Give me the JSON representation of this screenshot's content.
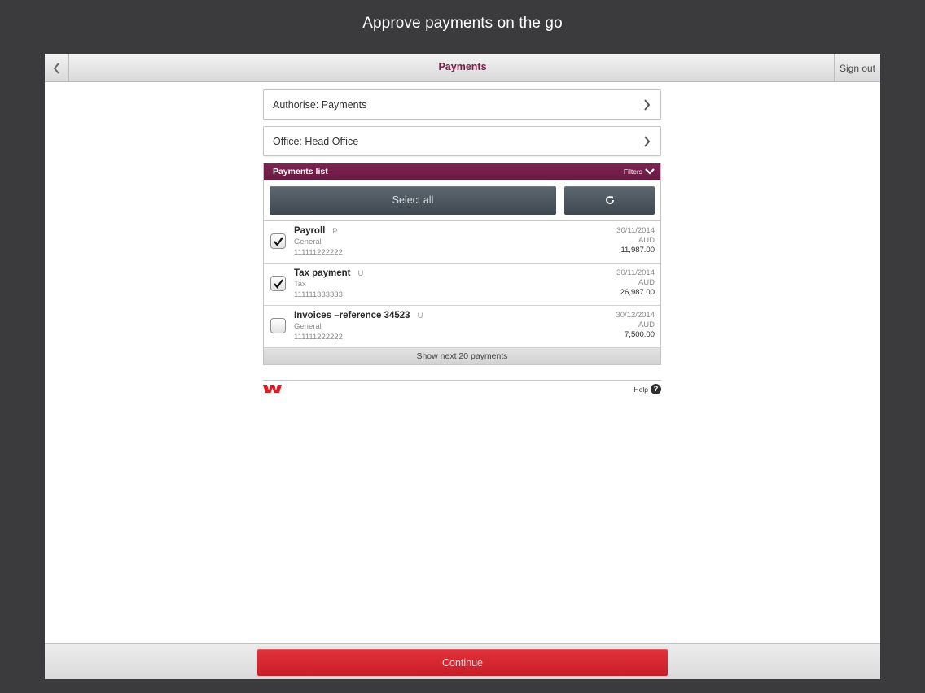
{
  "caption": "Approve payments on the go",
  "navbar": {
    "title": "Payments",
    "sign_out": "Sign out",
    "back_icon": "chevron-left-icon"
  },
  "selectors": [
    {
      "label": "Authorise: Payments"
    },
    {
      "label": "Office: Head Office"
    }
  ],
  "payments_panel": {
    "title": "Payments list",
    "filters_label": "Filters",
    "select_all_label": "Select all",
    "refresh_icon": "refresh-icon",
    "rows": [
      {
        "name": "Payroll",
        "code": "P",
        "type": "General",
        "account": "111111222222",
        "date": "30/11/2014",
        "currency": "AUD",
        "amount": "11,987.00",
        "checked": true
      },
      {
        "name": "Tax payment",
        "code": "U",
        "type": "Tax",
        "account": "111111333333",
        "date": "30/11/2014",
        "currency": "AUD",
        "amount": "26,987.00",
        "checked": true
      },
      {
        "name": "Invoices –reference 34523",
        "code": "U",
        "type": "General",
        "account": "111111222222",
        "date": "30/12/2014",
        "currency": "AUD",
        "amount": "7,500.00",
        "checked": false
      }
    ],
    "show_next": "Show next 20 payments"
  },
  "footer": {
    "help_label": "Help",
    "help_icon": "?",
    "logo": "westpac-logo"
  },
  "bottombar": {
    "continue_label": "Continue"
  },
  "colors": {
    "brand": "#7a1e4c",
    "continue": "#d4222c",
    "background": "#3b3a3c"
  }
}
